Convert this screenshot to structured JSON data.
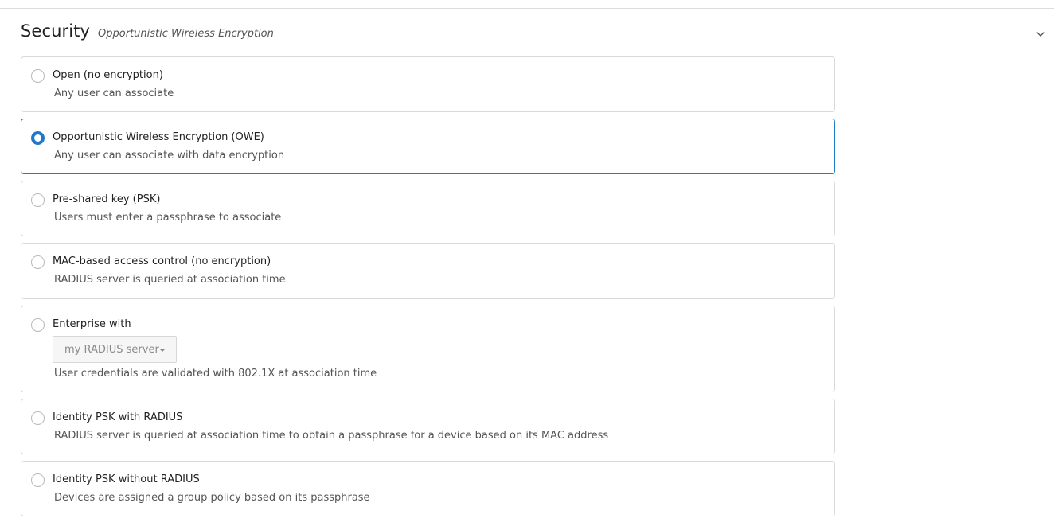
{
  "section": {
    "title": "Security",
    "subtitle": "Opportunistic Wireless Encryption",
    "toggle_icon": "chevron-down-icon"
  },
  "options": [
    {
      "title": "Open (no encryption)",
      "description": "Any user can associate",
      "selected": false
    },
    {
      "title": "Opportunistic Wireless Encryption (OWE)",
      "description": "Any user can associate with data encryption",
      "selected": true
    },
    {
      "title": "Pre-shared key (PSK)",
      "description": "Users must enter a passphrase to associate",
      "selected": false
    },
    {
      "title": "MAC-based access control (no encryption)",
      "description": "RADIUS server is queried at association time",
      "selected": false
    },
    {
      "title": "Enterprise with",
      "description": "User credentials are validated with 802.1X at association time",
      "selected": false,
      "select_value": "my RADIUS server",
      "select_disabled": true
    },
    {
      "title": "Identity PSK with RADIUS",
      "description": "RADIUS server is queried at association time to obtain a passphrase for a device based on its MAC address",
      "selected": false
    },
    {
      "title": "Identity PSK without RADIUS",
      "description": "Devices are assigned a group policy based on its passphrase",
      "selected": false
    }
  ],
  "colors": {
    "accent": "#1f78c9",
    "border": "#d9d9d9",
    "selected_border": "#1f7dc7"
  }
}
